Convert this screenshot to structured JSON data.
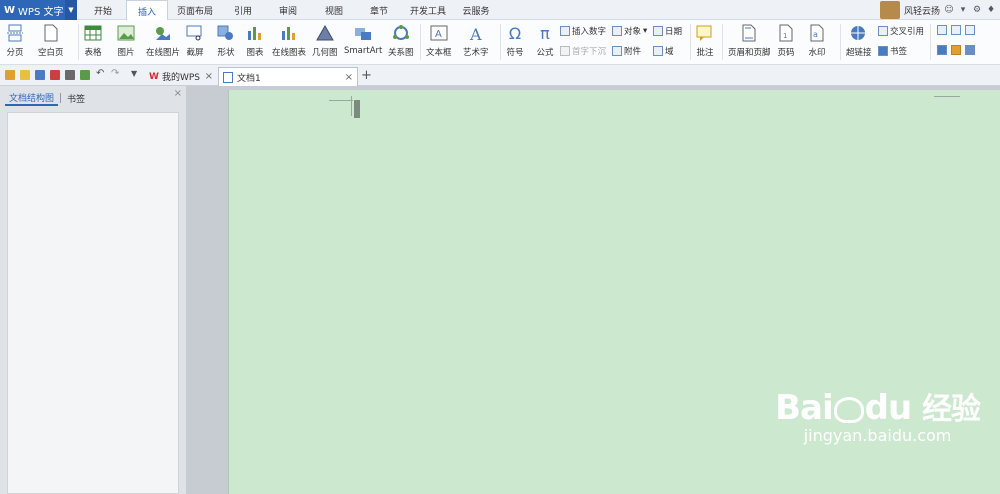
{
  "app": {
    "title": "WPS 文字"
  },
  "menu": [
    "开始",
    "插入",
    "页面布局",
    "引用",
    "审阅",
    "视图",
    "章节",
    "开发工具",
    "云服务"
  ],
  "active_menu": "插入",
  "user": {
    "name": "风轻云扬"
  },
  "ribbon": {
    "page_break": "分页",
    "blank_page": "空白页",
    "table": "表格",
    "picture": "图片",
    "online_picture": "在线图片",
    "screenshot": "截屏",
    "shapes": "形状",
    "chart": "图表",
    "online_chart": "在线图表",
    "geometry": "几何图",
    "smartart": "SmartArt",
    "relation_chart": "关系图",
    "textbox": "文本框",
    "wordart": "艺术字",
    "symbol": "符号",
    "formula": "公式",
    "insert_number": "插入数字",
    "drop_cap": "首字下沉",
    "object": "对象",
    "attachment": "附件",
    "date": "日期",
    "field": "域",
    "comment": "批注",
    "header_footer": "页眉和页脚",
    "page_number": "页码",
    "watermark": "水印",
    "hyperlink": "超链接",
    "cross_ref": "交叉引用",
    "bookmark": "书签"
  },
  "tabs": [
    {
      "label": "我的WPS"
    },
    {
      "label": "文档1"
    }
  ],
  "side": {
    "tab_outline": "文档结构图",
    "tab_bookmark": "书签"
  },
  "watermark": {
    "brand": "Bai",
    "brand2": "du",
    "brand_cn": "经验",
    "url": "jingyan.baidu.com"
  },
  "colors": {
    "accent": "#2e66b8",
    "page": "#cce8cf"
  }
}
